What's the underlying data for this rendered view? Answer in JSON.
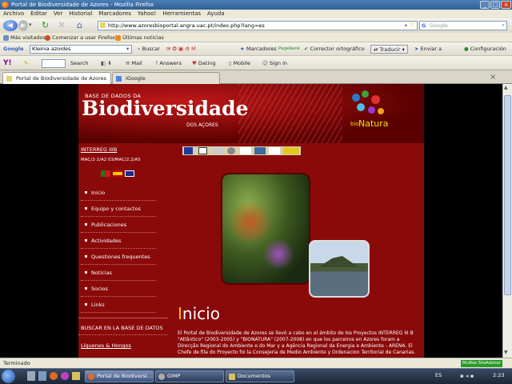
{
  "window": {
    "title": "Portal de Biodiversidade de Azores - Mozilla Firefox"
  },
  "menu": [
    "Archivo",
    "Editar",
    "Ver",
    "Historial",
    "Marcadores",
    "Yahoo!",
    "Herramientas",
    "Ayuda"
  ],
  "nav": {
    "url": "http://www.azoresbioportal.angra.uac.pt/index.php?lang=es",
    "search_placeholder": "Google"
  },
  "bookmarks": [
    "Más visitados",
    "Comenzar a usar Firefox",
    "Últimas noticias"
  ],
  "googlebar": {
    "logo": "Google",
    "query": "Kleinia azoides",
    "buscar": "Buscar",
    "marcadores": "Marcadores",
    "pagerank": "PageRank",
    "corrector": "Corrector ortográfico",
    "traducir": "Traducir",
    "enviar": "Enviar a",
    "configuracion": "Configuración"
  },
  "yahoobar": {
    "logo": "Y!",
    "search": "Search",
    "mail": "Mail",
    "answers": "Answers",
    "dating": "Dating",
    "mobile": "Mobile",
    "signin": "Sign in"
  },
  "tabs": [
    {
      "label": "Portal de Biodiversidade de Azores",
      "active": true
    },
    {
      "label": "iGoogle",
      "active": false
    }
  ],
  "site": {
    "banner_small": "BASE DE DADOS DA",
    "banner_title": "Biodiversidade",
    "banner_sub": "DOS AÇORES",
    "logo_bio": "bio",
    "logo_natura": "Natura",
    "interreg": "INTERREG IIIB",
    "interreg_code": "MAC/2-2/A2 03/MAC/2.2/A5",
    "menu": [
      "Inicio",
      "Equipo y contactos",
      "Publicaciones",
      "Actividades",
      "Questiones frequentes",
      "Noticias",
      "Socios",
      "Links"
    ],
    "search_db": "BUSCAR EN LA BASE DE DATOS",
    "liquenes": "Líquenes & Hongos",
    "heading_initial": "I",
    "heading_rest": "nicio",
    "paragraph": "El Portal de Biodiversidade de Azores se llevó a cabo en el ámbito de los Proyectos INTERREG III B \"Atlântico\" (2003-2005) y \"BIONATURA\" (2007-2008) en que los parceiros en Azores foram a Direcção Regional do Ambiente e do Mar y a Agência Regional da Energia e Ambiente - ARENA. El Chefe de fila do Proyecto foi la Consejeria de Medio Ambiente y Ordenacion Territorial de Canarias."
  },
  "status": {
    "text": "Terminado",
    "mcafee": "McAfee SiteAdvisor"
  },
  "taskbar": {
    "items": [
      "Portal de Biodiversi...",
      "GIMP",
      "Documentos"
    ],
    "lang": "ES",
    "clock": "2:23"
  },
  "colors": {
    "site_bg": "#8a0a0a",
    "banner": "#c01818",
    "black": "#000000"
  }
}
